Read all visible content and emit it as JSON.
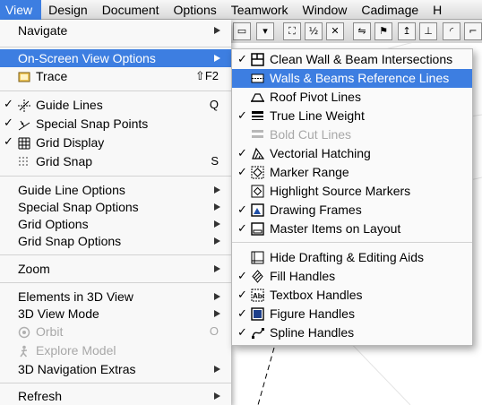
{
  "menubar": {
    "items": [
      "View",
      "Design",
      "Document",
      "Options",
      "Teamwork",
      "Window",
      "Cadimage",
      "H"
    ]
  },
  "view_menu": {
    "navigate": "Navigate",
    "on_screen_view_options": "On-Screen View Options",
    "trace": "Trace",
    "trace_shortcut": "⇧F2",
    "guide_lines": "Guide Lines",
    "guide_lines_shortcut": "Q",
    "special_snap_points": "Special Snap Points",
    "grid_display": "Grid Display",
    "grid_snap": "Grid Snap",
    "grid_snap_shortcut": "S",
    "guide_line_options": "Guide Line Options",
    "special_snap_options": "Special Snap Options",
    "grid_options": "Grid Options",
    "grid_snap_options": "Grid Snap Options",
    "zoom": "Zoom",
    "elements_in_3d_view": "Elements in 3D View",
    "3d_view_mode": "3D View Mode",
    "orbit": "Orbit",
    "orbit_shortcut": "O",
    "explore_model": "Explore Model",
    "3d_navigation_extras": "3D Navigation Extras",
    "refresh": "Refresh"
  },
  "submenu": {
    "clean_wall_beam": "Clean Wall & Beam Intersections",
    "walls_beams_reference_lines": "Walls & Beams Reference Lines",
    "roof_pivot_lines": "Roof Pivot Lines",
    "true_line_weight": "True Line Weight",
    "bold_cut_lines": "Bold Cut Lines",
    "vectorial_hatching": "Vectorial Hatching",
    "marker_range": "Marker Range",
    "highlight_source_markers": "Highlight Source Markers",
    "drawing_frames": "Drawing Frames",
    "master_items_on_layout": "Master Items on Layout",
    "hide_drafting_aids": "Hide Drafting & Editing Aids",
    "fill_handles": "Fill Handles",
    "textbox_handles": "Textbox Handles",
    "figure_handles": "Figure Handles",
    "spline_handles": "Spline Handles"
  },
  "checkmark": "✓",
  "colors": {
    "highlight": "#3d7ee1",
    "disabled": "#a8a8a8"
  }
}
